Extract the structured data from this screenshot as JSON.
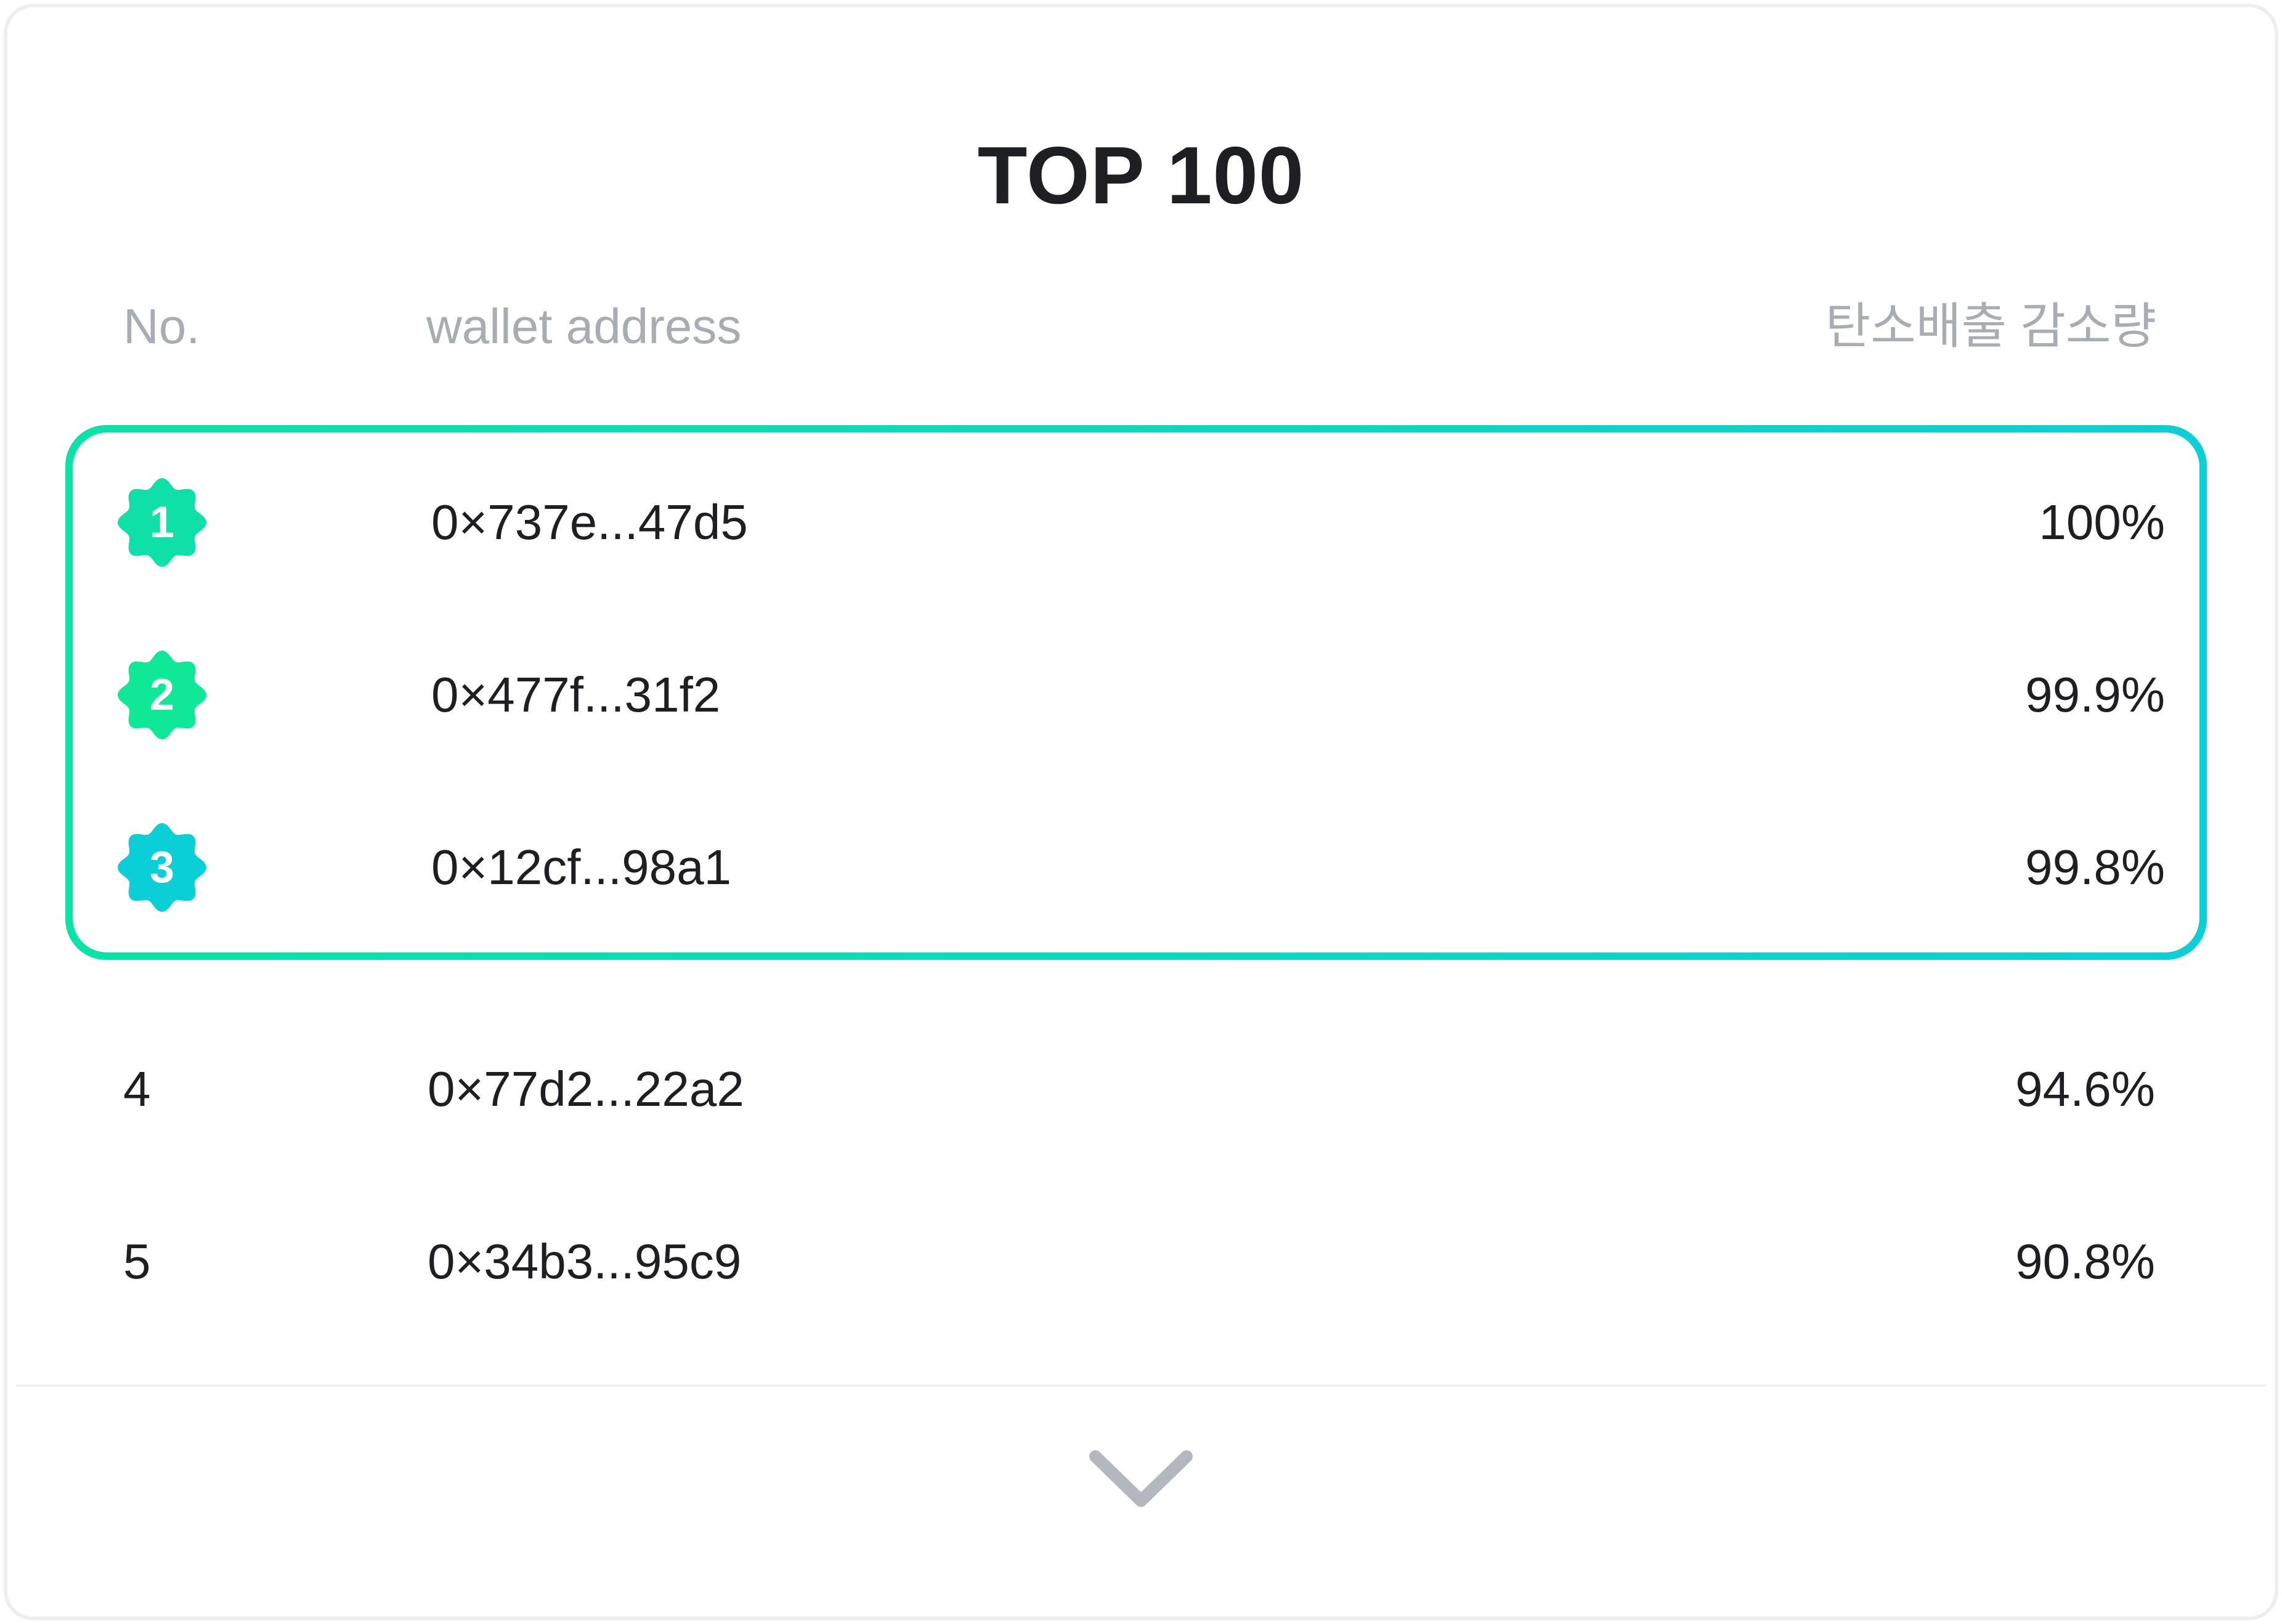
{
  "title": "TOP 100",
  "columns": {
    "no": "No.",
    "address": "wallet address",
    "amount": "탄소배출 감소량"
  },
  "top3": [
    {
      "rank": "1",
      "address": "0×737e...47d5",
      "amount": "100%",
      "badge_color": "#0ee0a8"
    },
    {
      "rank": "2",
      "address": "0×477f...31f2",
      "amount": "99.9%",
      "badge_color": "#0fe896"
    },
    {
      "rank": "3",
      "address": "0×12cf...98a1",
      "amount": "99.8%",
      "badge_color": "#0bcfd6"
    }
  ],
  "rows": [
    {
      "rank": "4",
      "address": "0×77d2...22a2",
      "amount": "94.6%"
    },
    {
      "rank": "5",
      "address": "0×34b3...95c9",
      "amount": "90.8%"
    }
  ],
  "icons": {
    "rank_badge": "scalloped-badge-icon",
    "expand": "chevron-down-icon"
  },
  "colors": {
    "highlight_gradient_start": "#08e3a6",
    "highlight_gradient_end": "#0bcfd6",
    "header_text": "#a7adb3",
    "body_text": "#1e1f22"
  }
}
